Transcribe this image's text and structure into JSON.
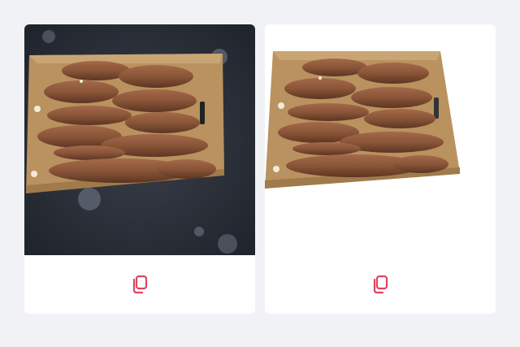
{
  "header": {
    "partial_text": "· · · · · ·"
  },
  "cards": [
    {
      "variant": "original",
      "background": "dark",
      "image_icon": "cassava-box-photo",
      "action_icon": "copy-icon"
    },
    {
      "variant": "background-removed",
      "background": "transparent",
      "image_icon": "cassava-box-cutout",
      "action_icon": "copy-icon"
    }
  ],
  "colors": {
    "page_bg": "#f1f2f5",
    "card_bg": "#ffffff",
    "accent": "#e0445e",
    "dark_bg": "#2a2e37"
  }
}
